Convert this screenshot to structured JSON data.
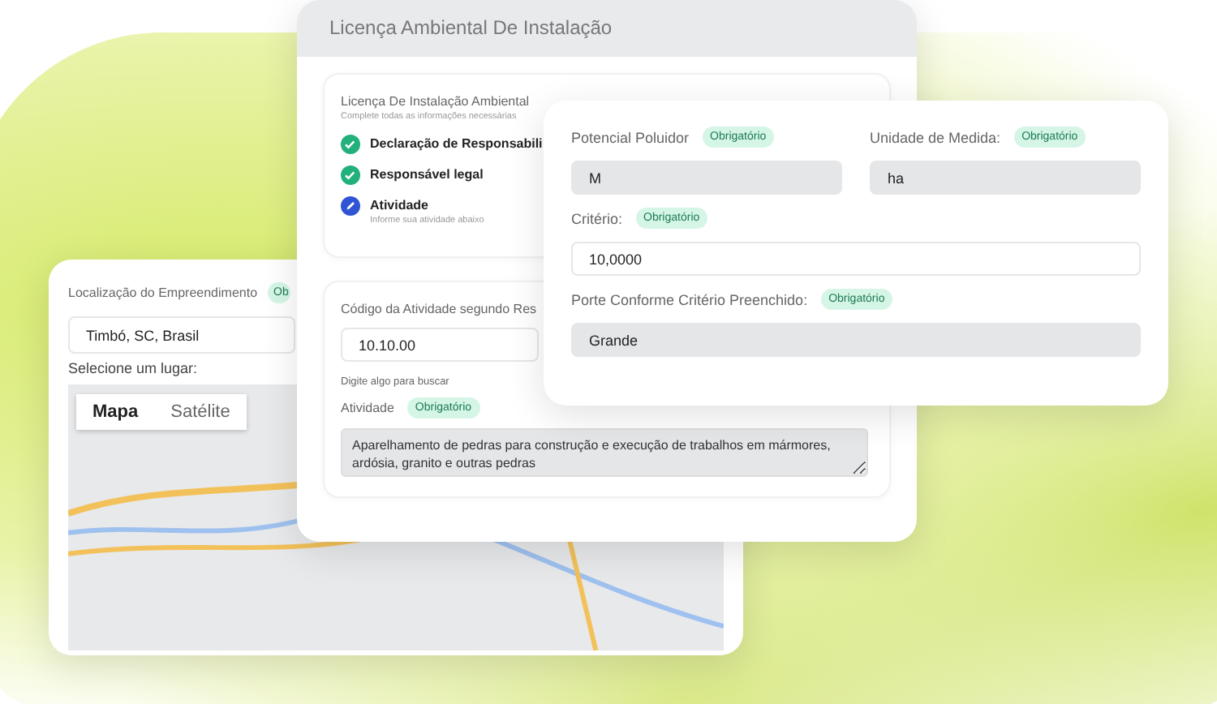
{
  "location_card": {
    "label": "Localização do Empreendimento",
    "badge": "Ob",
    "address": "Timbó, SC, Brasil",
    "prompt": "Selecione um lugar:",
    "map_tabs": [
      {
        "label": "Mapa",
        "selected": true
      },
      {
        "label": "Satélite",
        "selected": false
      }
    ]
  },
  "license_window": {
    "title": "Licença Ambiental De Instalação",
    "steps_card": {
      "title": "Licença De Instalação Ambiental",
      "subtitle": "Complete todas as informações necessárias",
      "steps": [
        {
          "label": "Declaração de Responsabili",
          "kind": "done"
        },
        {
          "label": "Responsável legal",
          "kind": "done"
        },
        {
          "label": "Atividade",
          "hint": "Informe sua atividade abaixo",
          "kind": "current"
        }
      ]
    },
    "activity_card": {
      "code_label": "Código da Atividade segundo Res",
      "code_value": "10.10.00",
      "code_hint": "Digite algo para buscar",
      "activity_label": "Atividade",
      "activity_badge": "Obrigatório",
      "activity_value": "Aparelhamento de pedras para construção e execução de trabalhos em mármores, ardósia, granito e outras pedras"
    }
  },
  "criteria_card": {
    "fields": [
      {
        "label": "Potencial Poluidor",
        "badge": "Obrigatório",
        "value": "M",
        "readonly": true
      },
      {
        "label": "Unidade de Medida:",
        "badge": "Obrigatório",
        "value": "ha",
        "readonly": true
      },
      {
        "label": "Critério:",
        "badge": "Obrigatório",
        "value": "10,0000",
        "readonly": false
      },
      {
        "label": "Porte Conforme Critério Preenchido:",
        "badge": "Obrigatório",
        "value": "Grande",
        "readonly": true
      }
    ]
  }
}
